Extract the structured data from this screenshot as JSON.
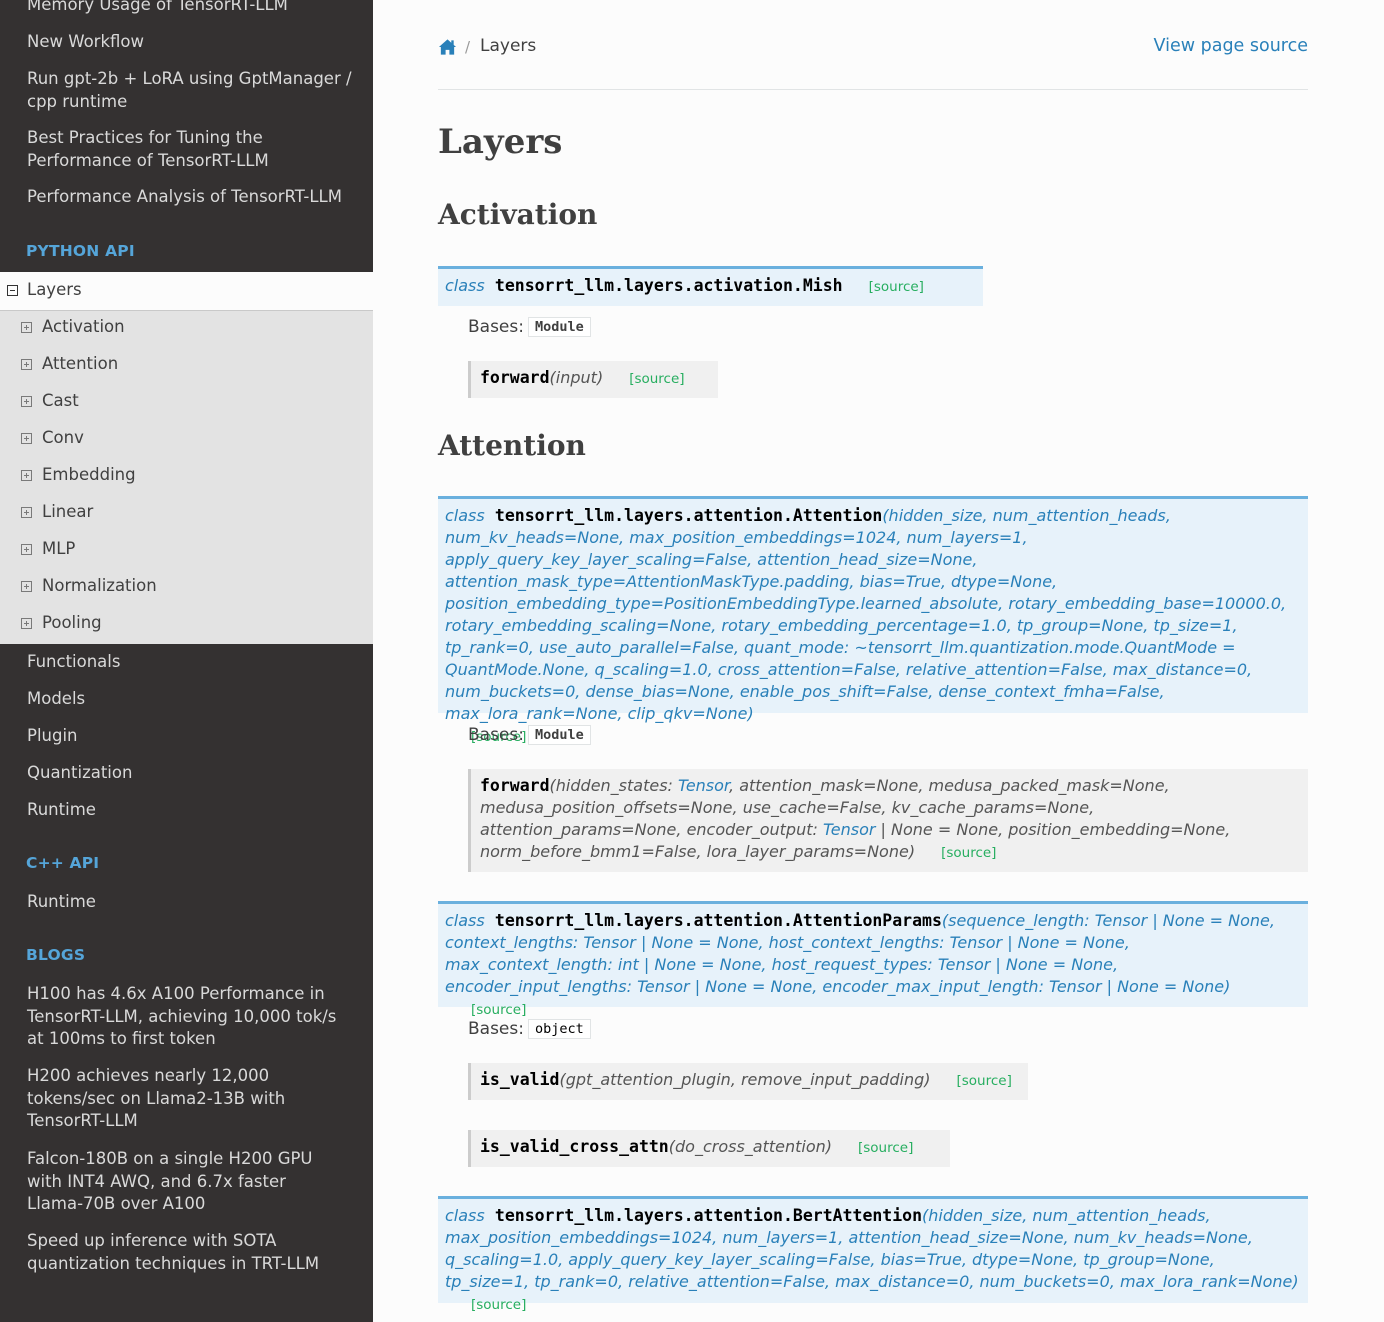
{
  "sidebar": {
    "top_items": [
      "Memory Usage of TensorRT-LLM",
      "New Workflow",
      "Run gpt-2b + LoRA using GptManager / cpp runtime",
      "Best Practices for Tuning the Performance of TensorRT-LLM",
      "Performance Analysis of TensorRT-LLM"
    ],
    "python_api_caption": "PYTHON API",
    "current": "Layers",
    "sub_items": [
      "Activation",
      "Attention",
      "Cast",
      "Conv",
      "Embedding",
      "Linear",
      "MLP",
      "Normalization",
      "Pooling"
    ],
    "python_items": [
      "Functionals",
      "Models",
      "Plugin",
      "Quantization",
      "Runtime"
    ],
    "cpp_api_caption": "C++ API",
    "cpp_items": [
      "Runtime"
    ],
    "blogs_caption": "BLOGS",
    "blog_items": [
      "H100 has 4.6x A100 Performance in TensorRT-LLM, achieving 10,000 tok/s at 100ms to first token",
      "H200 achieves nearly 12,000 tokens/sec on Llama2-13B with TensorRT-LLM",
      "Falcon-180B on a single H200 GPU with INT4 AWQ, and 6.7x faster Llama-70B over A100",
      "Speed up inference with SOTA quantization techniques in TRT-LLM"
    ]
  },
  "breadcrumb": {
    "sep": "/",
    "current": "Layers",
    "view_source": "View page source"
  },
  "content": {
    "title": "Layers",
    "section_activation": "Activation",
    "section_attention": "Attention",
    "class_kw": "class",
    "source_label": "[source]",
    "bases_label": "Bases:",
    "mish": {
      "name": "tensorrt_llm.layers.activation.Mish",
      "bases": "Module",
      "forward_name": "forward",
      "forward_params": "(input)"
    },
    "attention": {
      "name": "tensorrt_llm.layers.attention.Attention",
      "params": "(hidden_size, num_attention_heads, num_kv_heads=None, max_position_embeddings=1024, num_layers=1, apply_query_key_layer_scaling=False, attention_head_size=None, attention_mask_type=AttentionMaskType.padding, bias=True, dtype=None, position_embedding_type=PositionEmbeddingType.learned_absolute, rotary_embedding_base=10000.0, rotary_embedding_scaling=None, rotary_embedding_percentage=1.0, tp_group=None, tp_size=1, tp_rank=0, use_auto_parallel=False, quant_mode: ~tensorrt_llm.quantization.mode.QuantMode = QuantMode.None, q_scaling=1.0, cross_attention=False, relative_attention=False, max_distance=0, num_buckets=0, dense_bias=None, enable_pos_shift=False, dense_context_fmha=False, max_lora_rank=None, clip_qkv=None)",
      "bases": "Module",
      "forward_name": "forward",
      "fwd_p1": "(hidden_states: ",
      "fwd_t1": "Tensor",
      "fwd_p2": ", attention_mask=None, medusa_packed_mask=None, medusa_position_offsets=None, use_cache=False, kv_cache_params=None, attention_params=None, encoder_output: ",
      "fwd_t2": "Tensor",
      "fwd_p3": " | None = None, position_embedding=None, norm_before_bmm1=False, lora_layer_params=None)"
    },
    "attention_params": {
      "name": "tensorrt_llm.layers.attention.AttentionParams",
      "params": "(sequence_length: Tensor | None = None, context_lengths: Tensor | None = None, host_context_lengths: Tensor | None = None, max_context_length: int | None = None, host_request_types: Tensor | None = None, encoder_input_lengths: Tensor | None = None, encoder_max_input_length: Tensor | None = None)",
      "bases": "object",
      "is_valid_name": "is_valid",
      "is_valid_params": "(gpt_attention_plugin, remove_input_padding)",
      "is_valid_cross_name": "is_valid_cross_attn",
      "is_valid_cross_params": "(do_cross_attention)"
    },
    "bert_attention": {
      "name": "tensorrt_llm.layers.attention.BertAttention",
      "params": "(hidden_size, num_attention_heads, max_position_embeddings=1024, num_layers=1, attention_head_size=None, num_kv_heads=None, q_scaling=1.0, apply_query_key_layer_scaling=False, bias=True, dtype=None, tp_group=None, tp_size=1, tp_rank=0, relative_attention=False, max_distance=0, num_buckets=0, max_lora_rank=None)"
    }
  }
}
